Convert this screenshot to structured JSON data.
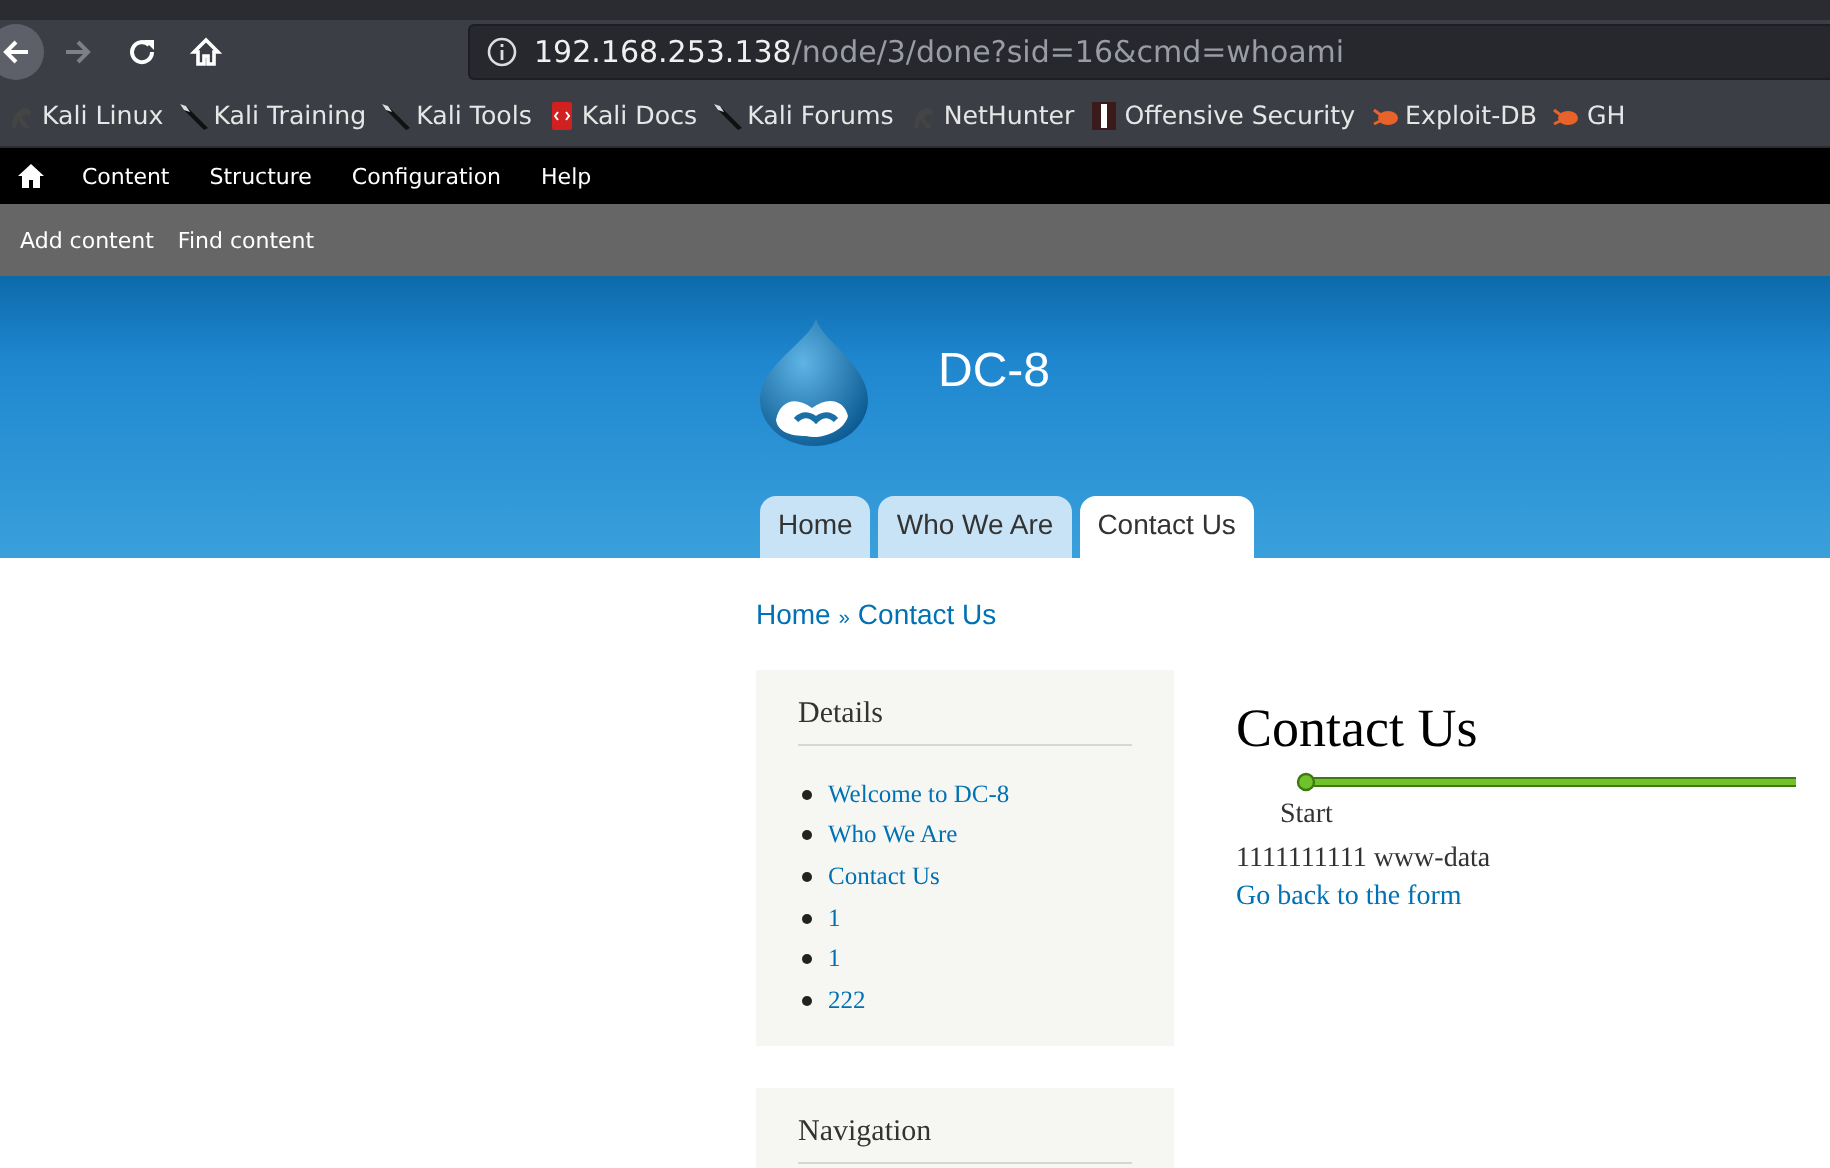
{
  "browser": {
    "url_host": "192.168.253.138",
    "url_path": "/node/3/done?sid=16&cmd=whoami",
    "bookmarks": [
      {
        "label": "Kali Linux",
        "kind": "dragon"
      },
      {
        "label": "Kali Training",
        "kind": "blade"
      },
      {
        "label": "Kali Tools",
        "kind": "blade"
      },
      {
        "label": "Kali Docs",
        "kind": "book"
      },
      {
        "label": "Kali Forums",
        "kind": "blade"
      },
      {
        "label": "NetHunter",
        "kind": "dragon"
      },
      {
        "label": "Offensive Security",
        "kind": "tower"
      },
      {
        "label": "Exploit-DB",
        "kind": "bug"
      },
      {
        "label": "GH",
        "kind": "bug"
      }
    ]
  },
  "admin_menu": [
    "Content",
    "Structure",
    "Configuration",
    "Help"
  ],
  "shortcuts": [
    "Add content",
    "Find content"
  ],
  "site": {
    "name": "DC-8",
    "tabs": [
      {
        "label": "Home",
        "selected": false
      },
      {
        "label": "Who We Are",
        "selected": false
      },
      {
        "label": "Contact Us",
        "selected": true
      }
    ]
  },
  "breadcrumb": {
    "items": [
      "Home",
      "Contact Us"
    ],
    "separator": "»"
  },
  "sidebar": [
    {
      "title": "Details",
      "items": [
        "Welcome to DC-8",
        "Who We Are",
        "Contact Us",
        "1",
        "1",
        "222"
      ]
    },
    {
      "title": "Navigation"
    }
  ],
  "main": {
    "title": "Contact Us",
    "progress_step": "Start",
    "message": "1111111111 www-data",
    "link": "Go back to the form"
  }
}
